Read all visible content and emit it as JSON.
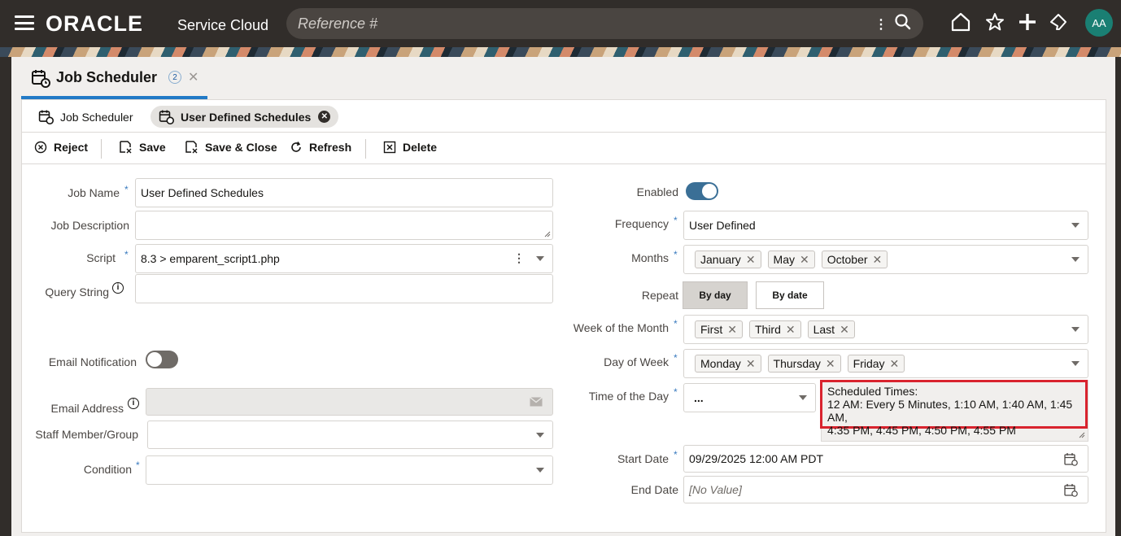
{
  "header": {
    "brand": "ORACLE",
    "product": "Service Cloud",
    "search_placeholder": "Reference #",
    "avatar_initials": "AA"
  },
  "main_tab": {
    "title": "Job Scheduler",
    "count": "2"
  },
  "subtabs": [
    {
      "label": "Job Scheduler"
    },
    {
      "label": "User Defined Schedules"
    }
  ],
  "toolbar": {
    "reject": "Reject",
    "save": "Save",
    "save_close": "Save & Close",
    "refresh": "Refresh",
    "delete": "Delete"
  },
  "form": {
    "job_name_label": "Job Name",
    "job_name_value": "User Defined Schedules",
    "job_description_label": "Job Description",
    "script_label": "Script",
    "script_value": "8.3 > emparent_script1.php",
    "query_string_label": "Query String",
    "email_notification_label": "Email Notification",
    "email_notification_enabled": false,
    "email_address_label": "Email Address",
    "staff_label": "Staff Member/Group",
    "condition_label": "Condition",
    "enabled_label": "Enabled",
    "enabled": true,
    "frequency_label": "Frequency",
    "frequency_value": "User Defined",
    "months_label": "Months",
    "months": [
      "January",
      "May",
      "October"
    ],
    "repeat_label": "Repeat",
    "repeat_by_day": "By day",
    "repeat_by_date": "By date",
    "week_label": "Week of the Month",
    "weeks": [
      "First",
      "Third",
      "Last"
    ],
    "dow_label": "Day of Week",
    "days": [
      "Monday",
      "Thursday",
      "Friday"
    ],
    "time_label": "Time of the Day",
    "time_value": "...",
    "scheduled_title": "Scheduled Times:",
    "scheduled_line1": "12 AM: Every 5 Minutes, 1:10 AM, 1:40 AM, 1:45 AM,",
    "scheduled_line2": "4:35 PM, 4:45 PM, 4:50 PM, 4:55 PM",
    "start_label": "Start Date",
    "start_value": "09/29/2025 12:00 AM PDT",
    "end_label": "End Date",
    "end_placeholder": "[No Value]"
  },
  "colors": {
    "header_bg": "#312d2a",
    "accent_blue": "#227ac6",
    "toggle_on": "#3a6f96",
    "highlight_red": "#d9232e"
  }
}
